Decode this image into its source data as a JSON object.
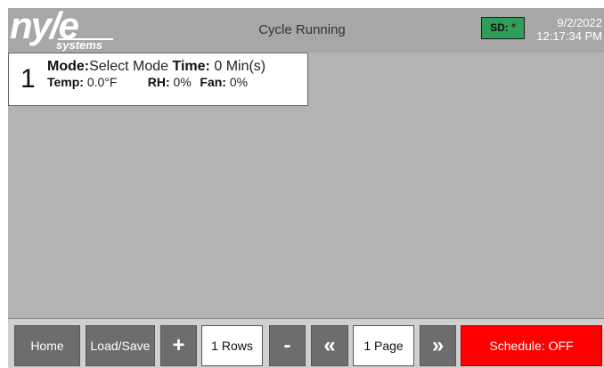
{
  "header": {
    "logo_main": "ny/e",
    "logo_sub": "systems",
    "status_title": "Cycle Running",
    "sd_badge": "SD: °",
    "date": "9/2/2022",
    "time": "12:17:34 PM"
  },
  "cycle_row": {
    "number": "1",
    "mode_label": "Mode:",
    "mode_value": "Select Mode",
    "time_label": "Time:",
    "time_value": "0 Min(s)",
    "temp_label": "Temp:",
    "temp_value": "0.0°F",
    "rh_label": "RH:",
    "rh_value": "0%",
    "fan_label": "Fan:",
    "fan_value": "0%"
  },
  "footer": {
    "home": "Home",
    "load_save": "Load/Save",
    "add": "+",
    "rows": "1 Rows",
    "remove": "-",
    "prev_page": "«",
    "page": "1 Page",
    "next_page": "»",
    "schedule": "Schedule: OFF"
  },
  "colors": {
    "header_bg": "#a7a7a7",
    "screen_bg": "#b3b3b3",
    "sd_badge": "#2e9e58",
    "button_dark": "#6d6d6d",
    "schedule_off": "#ff0000"
  }
}
